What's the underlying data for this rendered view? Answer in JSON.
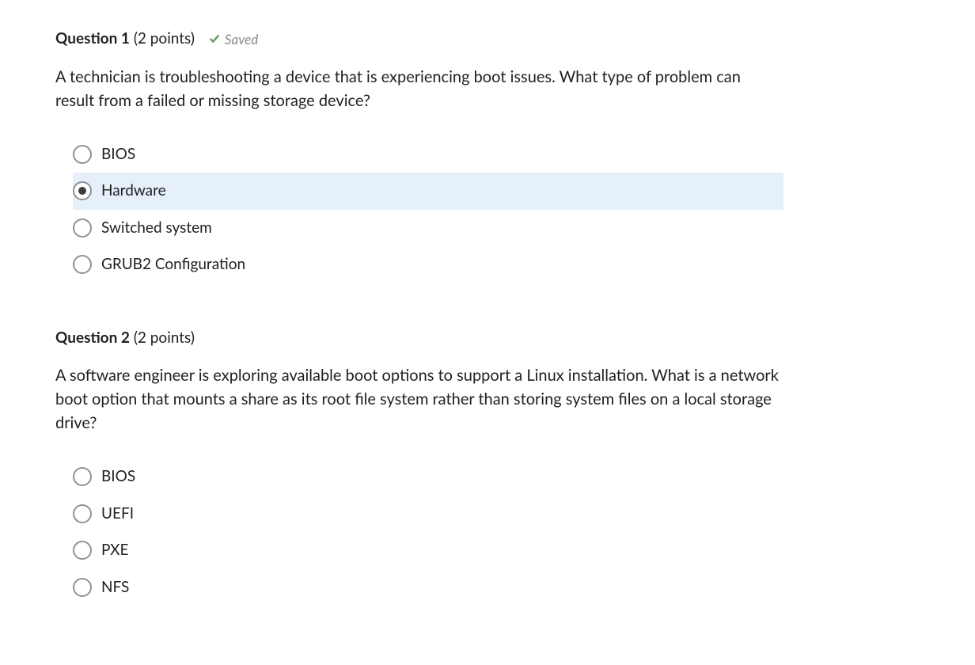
{
  "questions": [
    {
      "number": "Question 1",
      "points": "(2 points)",
      "saved": true,
      "saved_label": "Saved",
      "text": "A technician is troubleshooting a device that is experiencing boot issues. What type of problem can result from a failed or missing storage device?",
      "options": [
        {
          "label": "BIOS",
          "selected": false
        },
        {
          "label": "Hardware",
          "selected": true
        },
        {
          "label": "Switched system",
          "selected": false
        },
        {
          "label": "GRUB2 Configuration",
          "selected": false
        }
      ]
    },
    {
      "number": "Question 2",
      "points": "(2 points)",
      "saved": false,
      "saved_label": "",
      "text": "A software engineer is exploring available boot options to support a Linux installation. What is a network boot option that mounts a share as its root file system rather than storing system files on a local storage drive?",
      "options": [
        {
          "label": "BIOS",
          "selected": false
        },
        {
          "label": "UEFI",
          "selected": false
        },
        {
          "label": "PXE",
          "selected": false
        },
        {
          "label": "NFS",
          "selected": false
        }
      ]
    }
  ]
}
